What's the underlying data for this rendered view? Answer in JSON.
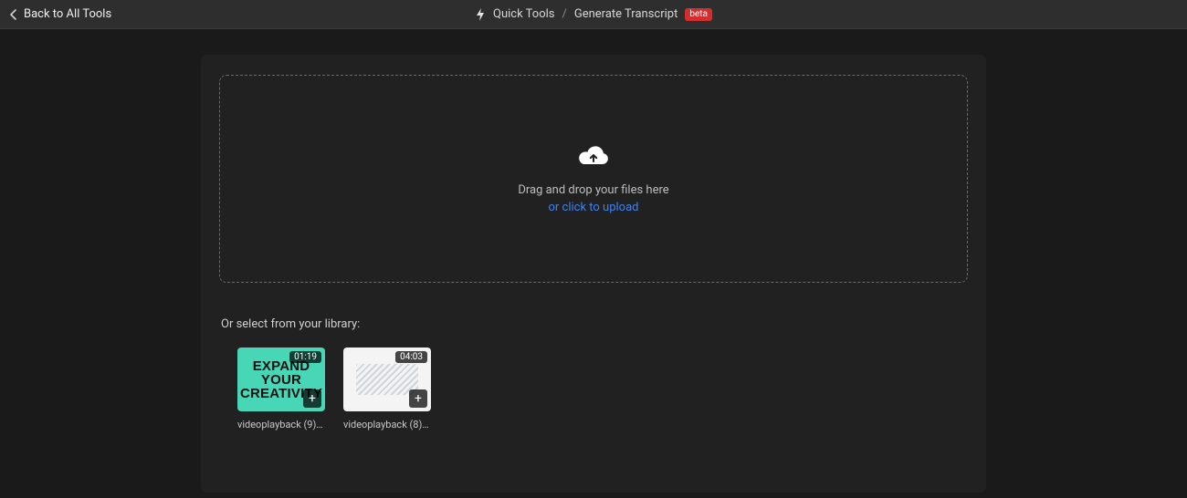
{
  "header": {
    "back_label": "Back to All Tools",
    "breadcrumb": {
      "root": "Quick Tools",
      "current": "Generate Transcript",
      "badge": "beta"
    }
  },
  "upload": {
    "instruction": "Drag and drop your files here",
    "link": "or click to upload"
  },
  "library": {
    "heading": "Or select from your library:",
    "items": [
      {
        "duration": "01:19",
        "name": "videoplayback (9)....",
        "thumb_text": "EXPAND YOUR CREATIVITY"
      },
      {
        "duration": "04:03",
        "name": "videoplayback (8)...."
      }
    ]
  }
}
